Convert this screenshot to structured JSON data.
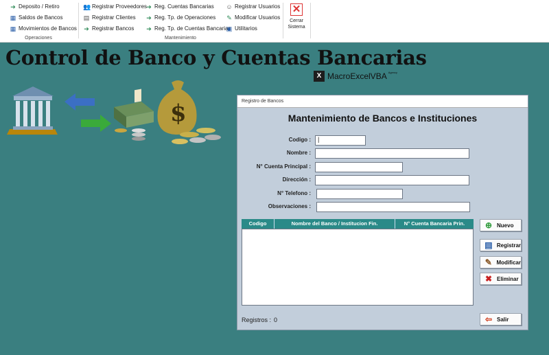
{
  "ribbon": {
    "operaciones": {
      "title": "Operaciones",
      "items": [
        {
          "label": "Deposito / Retiro",
          "icon": "arrow-right-icon"
        },
        {
          "label": "Saldos de Bancos",
          "icon": "table-icon"
        },
        {
          "label": "Movimientos de Bancos",
          "icon": "table-icon"
        }
      ]
    },
    "mantenimiento": {
      "title": "Mantenimiento",
      "col1": [
        {
          "label": "Registrar Proveedores",
          "icon": "users-icon"
        },
        {
          "label": "Registrar Clientes",
          "icon": "clipboard-icon"
        },
        {
          "label": "Registrar Bancos",
          "icon": "arrow-right-icon"
        }
      ],
      "col2": [
        {
          "label": "Reg. Cuentas Bancarias",
          "icon": "arrow-right-icon"
        },
        {
          "label": "Reg. Tp. de Operaciones",
          "icon": "arrow-right-icon"
        },
        {
          "label": "Reg. Tp. de Cuentas Bancarias",
          "icon": "arrow-right-icon"
        }
      ],
      "col3": [
        {
          "label": "Registrar Usuarios",
          "icon": "user-icon"
        },
        {
          "label": "Modificar Usuarios",
          "icon": "users-edit-icon"
        },
        {
          "label": "Utilitarios",
          "icon": "folder-icon"
        }
      ]
    },
    "close": {
      "label_line1": "Cerrar",
      "label_line2": "Sistema",
      "icon": "close-icon"
    }
  },
  "header": {
    "title": "Control de Banco y Cuentas Bancarias",
    "brand": "MacroExcelVBA",
    "brand_sup": "Agency"
  },
  "form": {
    "window_title": "Registro de Bancos",
    "heading": "Mantenimiento de Bancos e Instituciones",
    "fields": {
      "codigo": {
        "label": "Codigo :",
        "value": "|"
      },
      "nombre": {
        "label": "Nombre :",
        "value": ""
      },
      "cuenta": {
        "label": "N° Cuenta Principal :",
        "value": ""
      },
      "direccion": {
        "label": "Dirección :",
        "value": ""
      },
      "telefono": {
        "label": "N° Telefono :",
        "value": ""
      },
      "observaciones": {
        "label": "Observaciones :",
        "value": ""
      }
    },
    "list": {
      "columns": [
        "Codigo",
        "Nombre del Banco / Institucion Fin.",
        "N° Cuenta Bancaria Prin."
      ],
      "rows": []
    },
    "buttons": {
      "nuevo": "Nuevo",
      "registrar": "Registrar",
      "modificar": "Modificar",
      "eliminar": "Eliminar",
      "salir": "Salir"
    },
    "registros_label": "Registros :",
    "registros_count": "0"
  },
  "colors": {
    "background": "#3a7f80",
    "form_bg": "#c2cedb",
    "list_header": "#2a8a88"
  }
}
